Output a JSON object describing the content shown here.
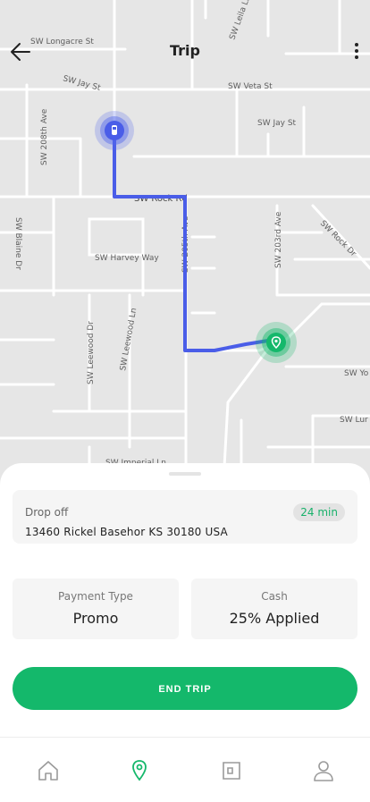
{
  "header": {
    "title": "Trip"
  },
  "map": {
    "streets": [
      "SW Longacre St",
      "SW Jay St",
      "SW Veta St",
      "SW Jay St",
      "SW 208th Ave",
      "SW Rock Rd",
      "SW Blaine Dr",
      "SW Harvey Way",
      "SW 203rd Ave",
      "SW Rock Dr",
      "SW Leewood Dr",
      "SW Leewood Ln",
      "SW Imperial Ln",
      "SW Yo",
      "SW Lur",
      "SW 205th Ave",
      "SW Leila Ln"
    ]
  },
  "dropoff": {
    "label": "Drop off",
    "eta": "24 min",
    "address": "13460 Rickel Basehor KS 30180 USA"
  },
  "payment": {
    "label": "Payment Type",
    "value": "Promo"
  },
  "cash": {
    "label": "Cash",
    "value": "25% Applied"
  },
  "actions": {
    "end_trip": "END TRIP"
  },
  "icons": {
    "back": "arrow-left-icon",
    "more": "more-vertical-icon",
    "car": "car-icon",
    "destination": "location-pin-icon",
    "tabs": [
      "home-icon",
      "location-pin-icon",
      "wallet-icon",
      "user-icon"
    ]
  },
  "colors": {
    "accent": "#14b86b",
    "route": "#4a5de8",
    "background": "#e6e6e6"
  }
}
